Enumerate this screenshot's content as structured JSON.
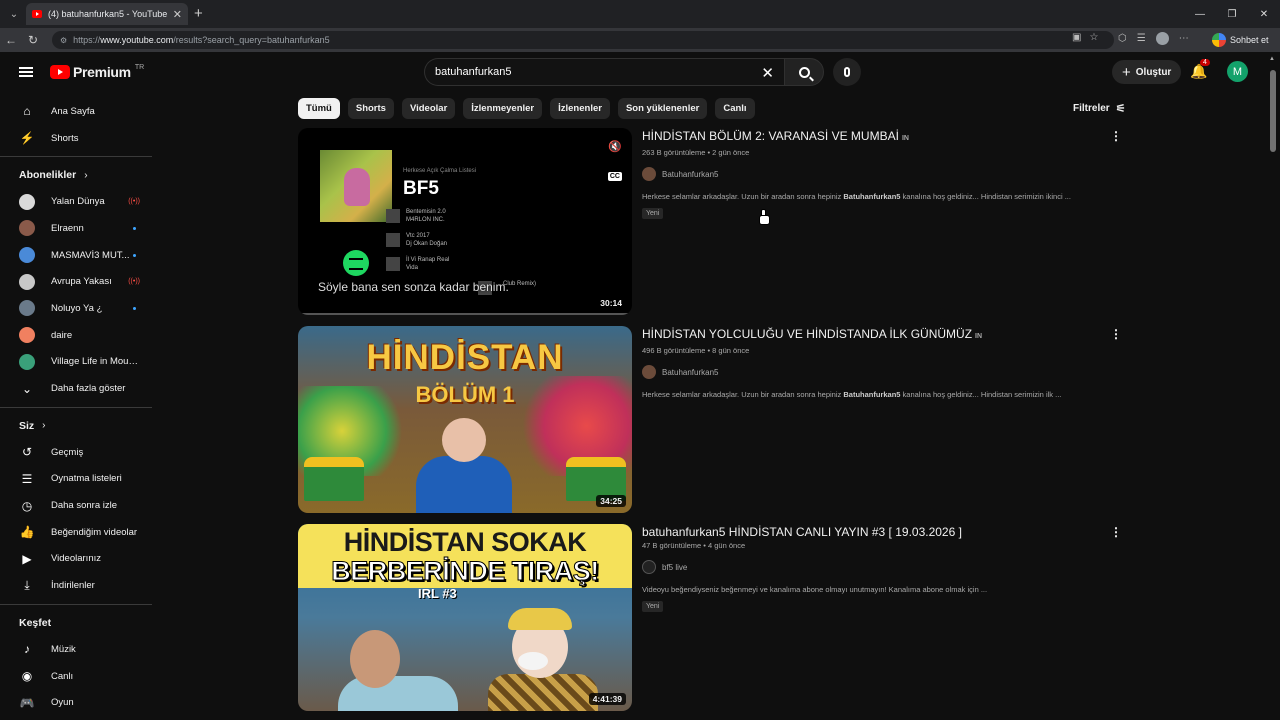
{
  "browser": {
    "tab_title": "(4) batuhanfurkan5 - YouTube",
    "url_prefix": "https://",
    "url_host": "www.youtube.com",
    "url_path": "/results?search_query=batuhanfurkan5",
    "chat_label": "Sohbet et"
  },
  "header": {
    "logo_text": "Premium",
    "logo_region": "TR",
    "search_value": "batuhanfurkan5",
    "create_label": "Oluştur",
    "notif_count": "4",
    "avatar_letter": "M"
  },
  "sidebar": {
    "main": [
      {
        "label": "Ana Sayfa",
        "icon": "home-icon"
      },
      {
        "label": "Shorts",
        "icon": "shorts-icon"
      }
    ],
    "subs_title": "Abonelikler",
    "subs": [
      {
        "label": "Yalan Dünya",
        "status": "live"
      },
      {
        "label": "Elraenn",
        "status": "new"
      },
      {
        "label": "MASMAVİ3 MUT...",
        "status": "new"
      },
      {
        "label": "Avrupa Yakası",
        "status": "live"
      },
      {
        "label": "Noluyo Ya ¿",
        "status": "new"
      },
      {
        "label": "daire",
        "status": ""
      },
      {
        "label": "Village Life in Moun...",
        "status": ""
      }
    ],
    "show_more": "Daha fazla göster",
    "you_title": "Siz",
    "you": [
      {
        "label": "Geçmiş",
        "icon": "history-icon"
      },
      {
        "label": "Oynatma listeleri",
        "icon": "playlists-icon"
      },
      {
        "label": "Daha sonra izle",
        "icon": "watch-later-icon"
      },
      {
        "label": "Beğendiğim videolar",
        "icon": "liked-icon"
      },
      {
        "label": "Videolarınız",
        "icon": "your-videos-icon"
      },
      {
        "label": "İndirilenler",
        "icon": "downloads-icon"
      }
    ],
    "explore_title": "Keşfet",
    "explore": [
      {
        "label": "Müzik",
        "icon": "music-icon"
      },
      {
        "label": "Canlı",
        "icon": "live-icon"
      },
      {
        "label": "Oyun",
        "icon": "gaming-icon"
      }
    ]
  },
  "chips": [
    "Tümü",
    "Shorts",
    "Videolar",
    "İzlenmeyenler",
    "İzlenenler",
    "Son yüklenenler",
    "Canlı"
  ],
  "filters_label": "Filtreler",
  "results": [
    {
      "title": "HİNDİSTAN BÖLÜM 2: VARANASİ VE MUMBAİ",
      "tv": "IN",
      "meta": "263 B görüntüleme • 2 gün önce",
      "channel": "Batuhanfurkan5",
      "desc_pre": "Herkese selamlar arkadaşlar. Uzun bir aradan sonra hepiniz ",
      "desc_bold": "Batuhanfurkan5",
      "desc_post": " kanalına hoş geldiniz... Hindistan serimizin ikinci ...",
      "badge": "Yeni",
      "duration": "30:14",
      "thumb": {
        "playlist_label": "Herkese Açık Çalma Listesi",
        "playlist_name": "BF5",
        "track1": "Bentemisin 2.0\nM4RLON INC.",
        "track2": "Vtc 2017\nDj Okan Doğan",
        "track3": "İl Vi Ranap Real\nVida",
        "track4": "...Club Remix)",
        "caption": "Söyle bana sen sonza kadar benim.",
        "cc_label": "CC"
      }
    },
    {
      "title": "HİNDİSTAN YOLCULUĞU VE HİNDİSTANDA İLK GÜNÜMÜZ",
      "tv": "IN",
      "meta": "496 B görüntüleme • 8 gün önce",
      "channel": "Batuhanfurkan5",
      "desc_pre": "Herkese selamlar arkadaşlar. Uzun bir aradan sonra hepiniz ",
      "desc_bold": "Batuhanfurkan5",
      "desc_post": " kanalına hoş geldiniz... Hindistan serimizin ilk ...",
      "duration": "34:25",
      "thumb": {
        "line1": "HİNDİSTAN",
        "line2": "BÖLÜM 1"
      }
    },
    {
      "title": "batuhanfurkan5 HİNDİSTAN CANLI YAYIN #3 [ 19.03.2026 ]",
      "meta": "47 B görüntüleme • 4 gün önce",
      "channel": "bf5 live",
      "desc": "Videoyu beğendiyseniz beğenmeyi ve kanalıma abone olmayı unutmayın! Kanalıma abone olmak için ...",
      "badge": "Yeni",
      "duration": "4:41:39",
      "thumb": {
        "line1": "HİNDİSTAN SOKAK",
        "line2": "BERBERİNDE TIRAŞ!",
        "tag": "IRL #3"
      }
    }
  ],
  "colors": {
    "accent": "#ff0000",
    "background": "#0f0f0f",
    "chip": "#272727",
    "live": "#ff4e45",
    "new_dot": "#3ea6ff"
  }
}
